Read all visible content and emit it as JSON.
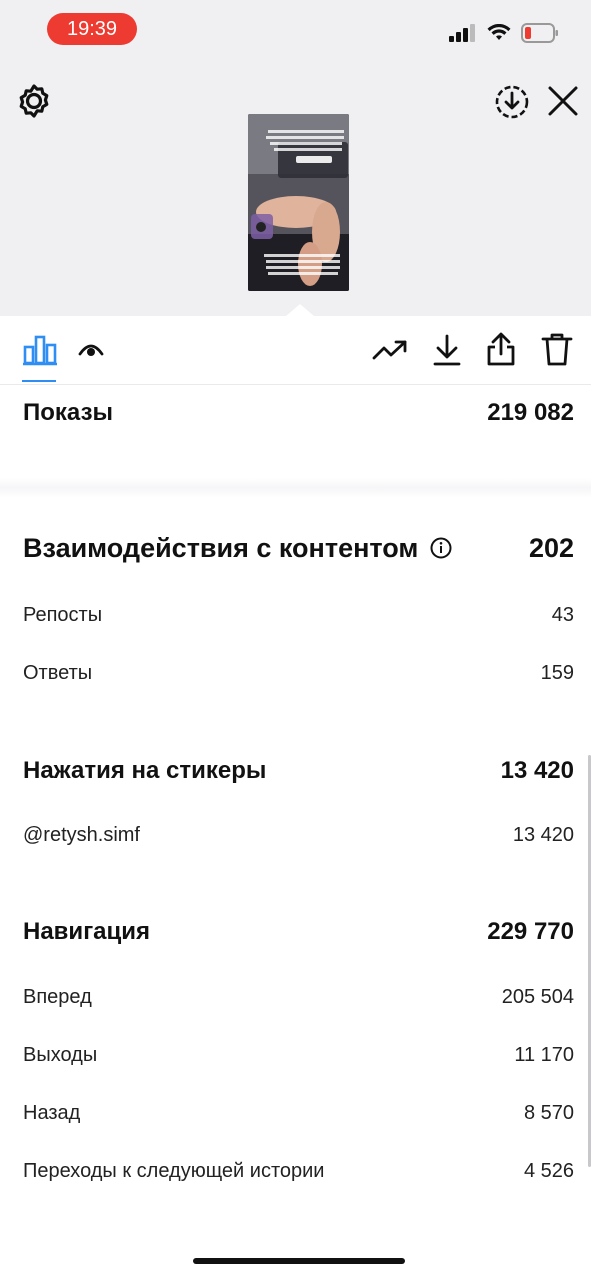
{
  "status_bar": {
    "time": "19:39"
  },
  "preview": {
    "settings_icon": "gear-icon",
    "download_icon": "download-circle-icon",
    "close_icon": "close-icon"
  },
  "toolbar": {
    "tabs": [
      "bar-chart-icon",
      "eye-icon"
    ],
    "actions": [
      "trending-icon",
      "download-icon",
      "share-icon",
      "trash-icon"
    ],
    "accent": "#2f8ef4"
  },
  "impressions": {
    "label": "Показы",
    "value": "219 082"
  },
  "interactions": {
    "label": "Взаимодействия с контентом",
    "value": "202",
    "rows": [
      {
        "label": "Репосты",
        "value": "43"
      },
      {
        "label": "Ответы",
        "value": "159"
      }
    ]
  },
  "stickers": {
    "label": "Нажатия на стикеры",
    "value": "13 420",
    "rows": [
      {
        "label": "@retysh.simf",
        "value": "13 420"
      }
    ]
  },
  "navigation": {
    "label": "Навигация",
    "value": "229 770",
    "rows": [
      {
        "label": "Вперед",
        "value": "205 504"
      },
      {
        "label": "Выходы",
        "value": "11 170"
      },
      {
        "label": "Назад",
        "value": "8 570"
      },
      {
        "label": "Переходы к следующей истории",
        "value": "4 526"
      }
    ]
  }
}
